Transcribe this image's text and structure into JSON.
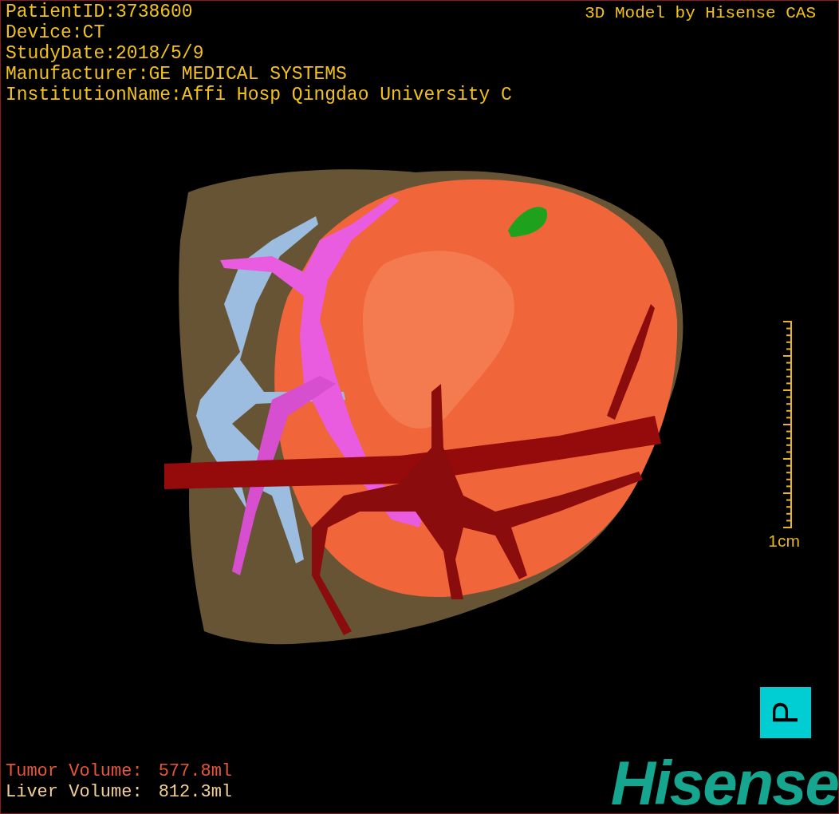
{
  "patient_info": [
    "PatientID:3738600",
    "Device:CT",
    "StudyDate:2018/5/9",
    "Manufacturer:GE MEDICAL SYSTEMS",
    "InstitutionName:Affi Hosp Qingdao University C"
  ],
  "credit": "3D Model by Hisense CAS",
  "scale": {
    "label": "1cm"
  },
  "orientation_button": {
    "label": "P"
  },
  "volumes": [
    {
      "kind": "tumor",
      "label": "Tumor Volume:",
      "value": "577.8ml"
    },
    {
      "kind": "liver",
      "label": "Liver Volume:",
      "value": "812.3ml"
    }
  ],
  "logo": "Hisense"
}
